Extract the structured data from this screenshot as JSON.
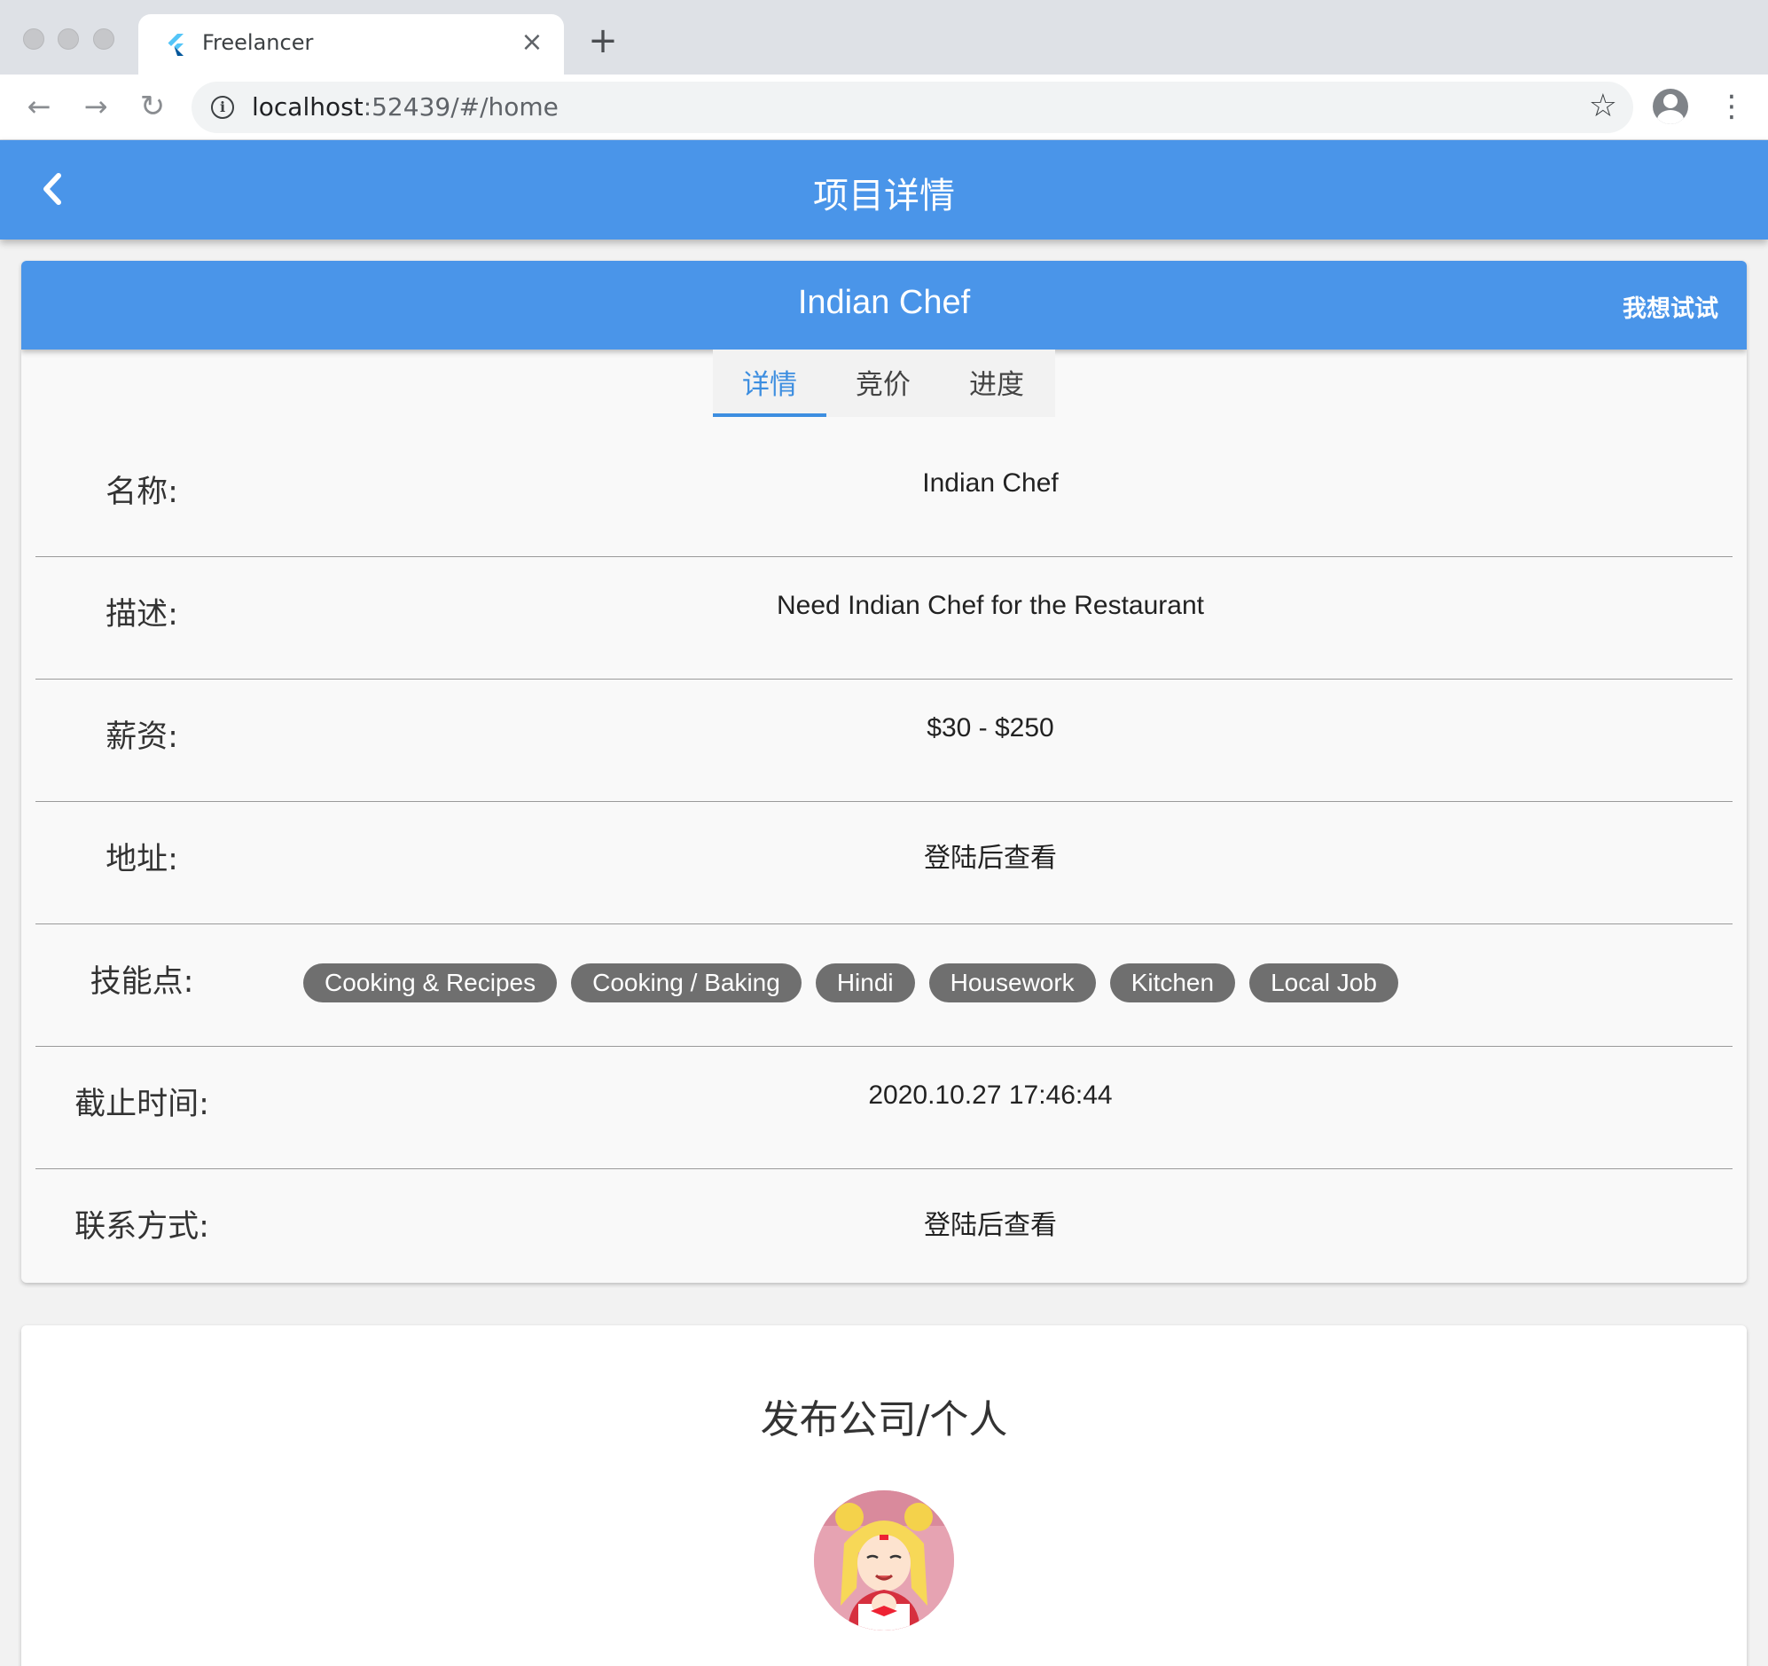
{
  "browser": {
    "tab_title": "Freelancer",
    "tab_close": "×",
    "new_tab": "+",
    "url_host": "localhost",
    "url_rest": ":52439/#/home",
    "star": "☆",
    "menu": "⋮",
    "icons": [
      "flutter-icon",
      "close-icon",
      "plus-icon",
      "back-arrow-icon",
      "forward-arrow-icon",
      "reload-icon",
      "info-icon",
      "star-icon",
      "profile-icon",
      "kebab-menu-icon"
    ]
  },
  "appbar": {
    "title": "项目详情",
    "back_icon": "chevron-left-icon"
  },
  "project": {
    "title": "Indian Chef",
    "try_label": "我想试试",
    "tabs": [
      "详情",
      "竞价",
      "进度"
    ],
    "selected_tab": 0,
    "rows": [
      {
        "label": "名称:",
        "value": "Indian Chef"
      },
      {
        "label": "描述:",
        "value": "Need Indian Chef for the Restaurant"
      },
      {
        "label": "薪资:",
        "value": "$30 - $250"
      },
      {
        "label": "地址:",
        "value": "登陆后查看"
      },
      {
        "label": "技能点:",
        "skills": [
          "Cooking & Recipes",
          "Cooking / Baking",
          "Hindi",
          "Housework",
          "Kitchen",
          "Local Job"
        ]
      },
      {
        "label": "截止时间:",
        "value": "2020.10.27 17:46:44"
      },
      {
        "label": "联系方式:",
        "value": "登陆后查看"
      }
    ]
  },
  "publisher": {
    "title": "发布公司/个人"
  },
  "colors": {
    "primary": "#4a95e9",
    "tab_active": "#3d8ee0",
    "chip_bg": "#6f6f6f",
    "page_bg": "#f2f2f2"
  }
}
